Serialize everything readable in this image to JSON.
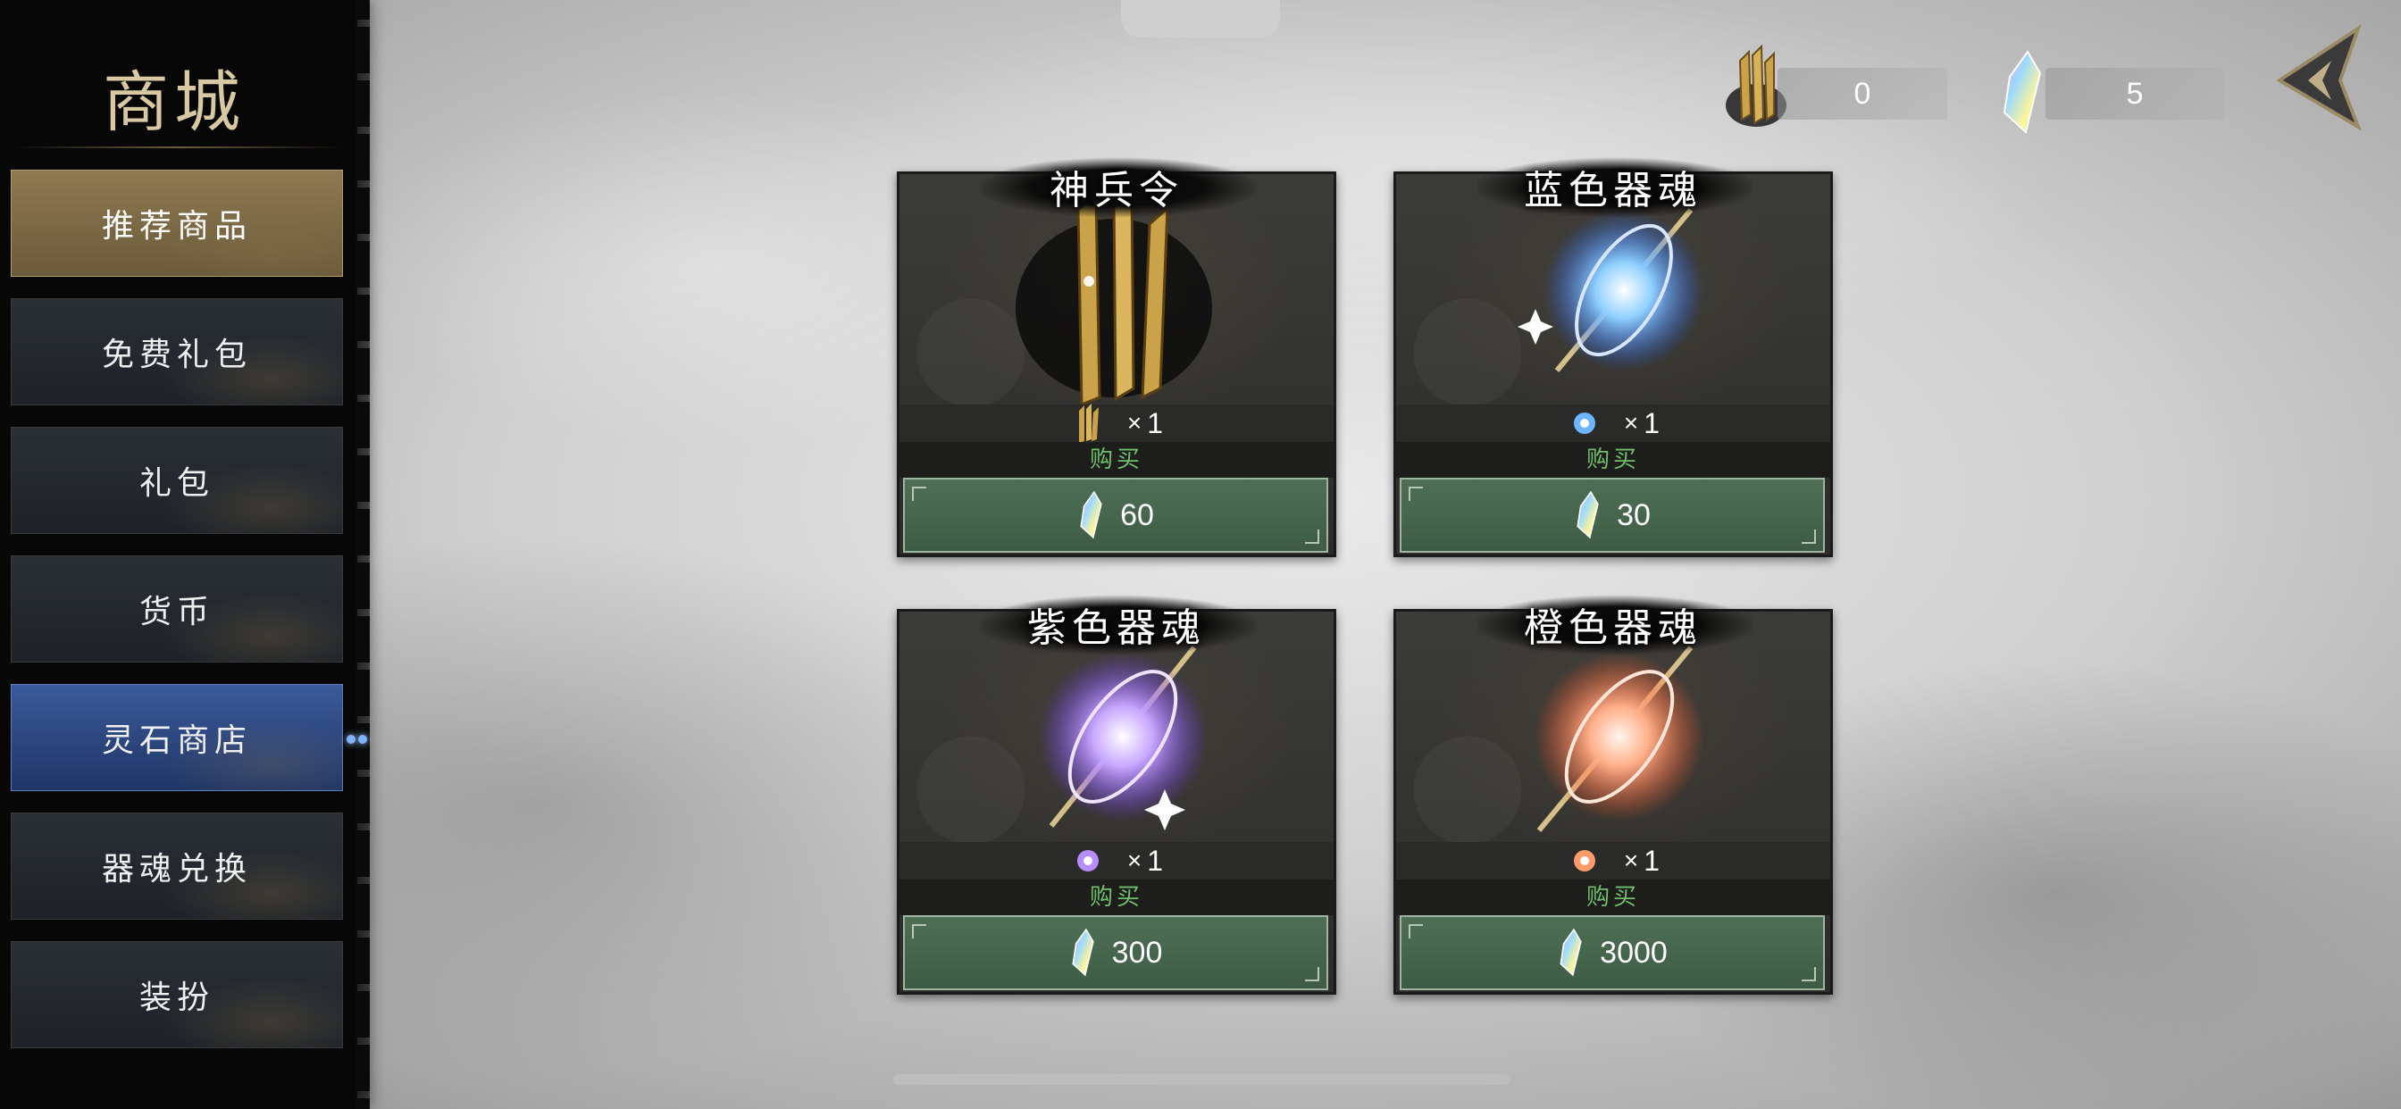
{
  "sidebar": {
    "title": "商城",
    "items": [
      {
        "label": "推荐商品"
      },
      {
        "label": "免费礼包"
      },
      {
        "label": "礼包"
      },
      {
        "label": "货币"
      },
      {
        "label": "灵石商店"
      },
      {
        "label": "器魂兑换"
      },
      {
        "label": "装扮"
      }
    ],
    "active_item": "灵石商店"
  },
  "currencies": [
    {
      "icon": "token-icon",
      "value": "0"
    },
    {
      "icon": "crystal-icon",
      "value": "5"
    }
  ],
  "shop": {
    "items": [
      {
        "name": "神兵令",
        "qty_symbol": "×",
        "qty": "1",
        "buy_label": "购买",
        "price": "60",
        "color": "#c9a24a"
      },
      {
        "name": "蓝色器魂",
        "qty_symbol": "×",
        "qty": "1",
        "buy_label": "购买",
        "price": "30",
        "color": "#6fb4ff"
      },
      {
        "name": "紫色器魂",
        "qty_symbol": "×",
        "qty": "1",
        "buy_label": "购买",
        "price": "300",
        "color": "#b68cff"
      },
      {
        "name": "橙色器魂",
        "qty_symbol": "×",
        "qty": "1",
        "buy_label": "购买",
        "price": "3000",
        "color": "#ff9a6a"
      }
    ]
  },
  "colors": {
    "accent_buy": "#4e6f55",
    "active_tab": "#3b5a9a",
    "featured_tab": "#8e7a52"
  }
}
